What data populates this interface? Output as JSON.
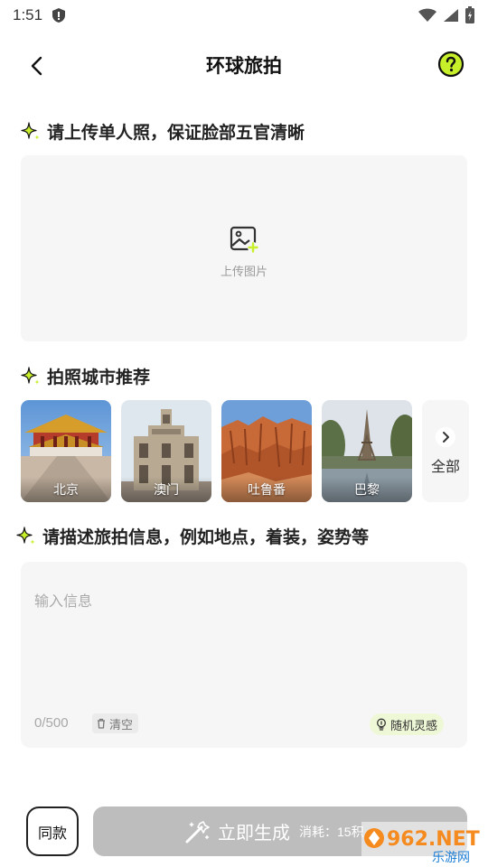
{
  "status_bar": {
    "time": "1:51"
  },
  "header": {
    "title": "环球旅拍"
  },
  "upload_section": {
    "title": "请上传单人照，保证脸部五官清晰",
    "upload_label": "上传图片"
  },
  "city_section": {
    "title": "拍照城市推荐",
    "cities": [
      {
        "name": "北京"
      },
      {
        "name": "澳门"
      },
      {
        "name": "吐鲁番"
      },
      {
        "name": "巴黎"
      }
    ],
    "all_label": "全部"
  },
  "desc_section": {
    "title": "请描述旅拍信息，例如地点，着装，姿势等",
    "input_placeholder": "输入信息",
    "input_value": "",
    "char_count": "0/500",
    "clear_label": "清空",
    "inspire_label": "随机灵感"
  },
  "footer": {
    "same_label": "同款",
    "generate_label": "立即生成",
    "cost_label": "消耗：15积"
  },
  "watermark": {
    "number": "962.NET",
    "sub": "乐游网"
  },
  "colors": {
    "accent_green": "#c7ef2a",
    "disabled_button": "#bdbdbd",
    "card_bg": "#f6f6f6"
  }
}
